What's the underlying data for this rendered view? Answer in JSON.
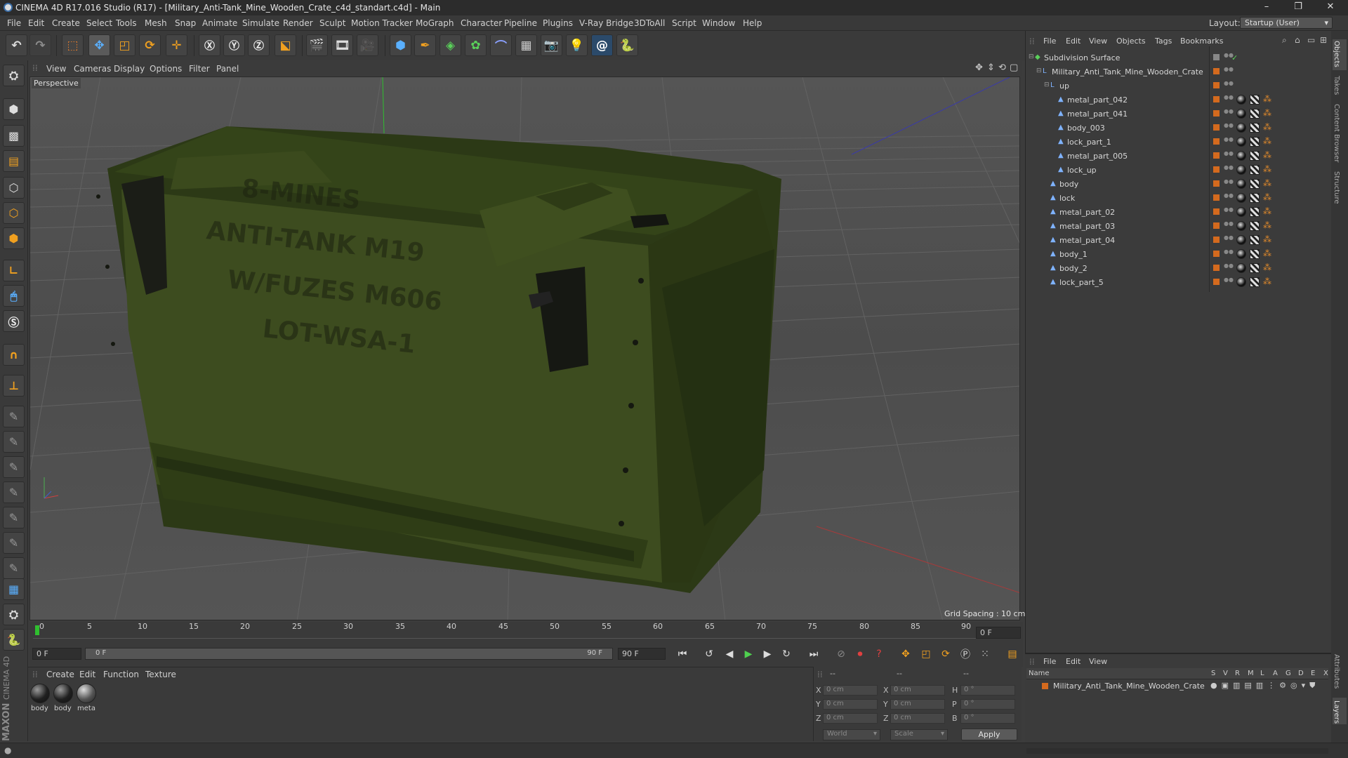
{
  "window": {
    "title": "CINEMA 4D R17.016 Studio (R17) - [Military_Anti-Tank_Mine_Wooden_Crate_c4d_standart.c4d] - Main",
    "minimize": "–",
    "maximize": "❐",
    "close": "✕"
  },
  "menubar": {
    "items": [
      "File",
      "Edit",
      "Create",
      "Select",
      "Tools",
      "Mesh",
      "Snap",
      "Animate",
      "Simulate",
      "Render",
      "Sculpt",
      "Motion Tracker",
      "MoGraph",
      "Character",
      "Pipeline",
      "Plugins",
      "V-Ray Bridge",
      "3DToAll",
      "Script",
      "Window",
      "Help"
    ],
    "layout_label": "Layout:",
    "layout_value": "Startup (User)"
  },
  "viewport": {
    "menu": [
      "View",
      "Cameras",
      "Display",
      "Options",
      "Filter",
      "Panel"
    ],
    "label": "Perspective",
    "grid_spacing": "Grid Spacing : 10 cm",
    "stencil_lines": [
      "8-MINES",
      "ANTI-TANK M19",
      "W/FUZES M606",
      "LOT-WSA-1"
    ]
  },
  "timeline": {
    "ticks": [
      "0",
      "5",
      "10",
      "15",
      "20",
      "25",
      "30",
      "35",
      "40",
      "45",
      "50",
      "55",
      "60",
      "65",
      "70",
      "75",
      "80",
      "85",
      "90"
    ],
    "current_frame_box": "0 F",
    "start_field": "0 F",
    "slider_start": "0 F",
    "slider_end": "90 F",
    "end_field": "90 F"
  },
  "materials": {
    "menu": [
      "Create",
      "Edit",
      "Function",
      "Texture"
    ],
    "items": [
      {
        "label": "body"
      },
      {
        "label": "body"
      },
      {
        "label": "meta"
      }
    ]
  },
  "coordinates": {
    "header_left": "--",
    "header_mid": "--",
    "header_right": "--",
    "rows": [
      {
        "a": "X",
        "av": "0 cm",
        "b": "X",
        "bv": "0 cm",
        "c": "H",
        "cv": "0 °"
      },
      {
        "a": "Y",
        "av": "0 cm",
        "b": "Y",
        "bv": "0 cm",
        "c": "P",
        "cv": "0 °"
      },
      {
        "a": "Z",
        "av": "0 cm",
        "b": "Z",
        "bv": "0 cm",
        "c": "B",
        "cv": "0 °"
      }
    ],
    "space": "World",
    "mode": "Scale",
    "apply": "Apply"
  },
  "object_manager": {
    "menu": [
      "File",
      "Edit",
      "View",
      "Objects",
      "Tags",
      "Bookmarks"
    ],
    "tree": [
      {
        "name": "Subdivision Surface",
        "depth": 0,
        "tags": false
      },
      {
        "name": "Military_Anti_Tank_Mine_Wooden_Crate",
        "depth": 1,
        "tags": false
      },
      {
        "name": "up",
        "depth": 2,
        "tags": false
      },
      {
        "name": "metal_part_042",
        "depth": 3,
        "tags": true
      },
      {
        "name": "metal_part_041",
        "depth": 3,
        "tags": true
      },
      {
        "name": "body_003",
        "depth": 3,
        "tags": true
      },
      {
        "name": "lock_part_1",
        "depth": 3,
        "tags": true
      },
      {
        "name": "metal_part_005",
        "depth": 3,
        "tags": true
      },
      {
        "name": "lock_up",
        "depth": 3,
        "tags": true
      },
      {
        "name": "body",
        "depth": 2,
        "tags": true
      },
      {
        "name": "lock",
        "depth": 2,
        "tags": true
      },
      {
        "name": "metal_part_02",
        "depth": 2,
        "tags": true
      },
      {
        "name": "metal_part_03",
        "depth": 2,
        "tags": true
      },
      {
        "name": "metal_part_04",
        "depth": 2,
        "tags": true
      },
      {
        "name": "body_1",
        "depth": 2,
        "tags": true
      },
      {
        "name": "body_2",
        "depth": 2,
        "tags": true
      },
      {
        "name": "lock_part_5",
        "depth": 2,
        "tags": true
      }
    ]
  },
  "layers_manager": {
    "menu": [
      "File",
      "Edit",
      "View"
    ],
    "name_header": "Name",
    "col_headers": [
      "S",
      "V",
      "R",
      "M",
      "L",
      "A",
      "G",
      "D",
      "E",
      "X"
    ],
    "row": "Military_Anti_Tank_Mine_Wooden_Crate"
  },
  "side_tabs": [
    "Objects",
    "Takes",
    "Content Browser",
    "Structure",
    "Attributes",
    "Layers"
  ],
  "branding": [
    "MAXON",
    "CINEMA 4D"
  ],
  "colors": {
    "accent": "#d46a1e",
    "crate": "#3a4a1c",
    "selection": "#4a6fa5"
  }
}
